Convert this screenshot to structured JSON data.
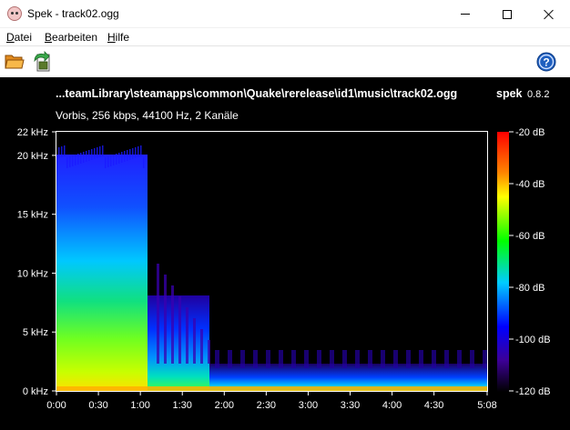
{
  "window": {
    "title": "Spek - track02.ogg",
    "controls": [
      "minimize",
      "maximize",
      "close"
    ]
  },
  "menu": {
    "items": [
      {
        "label": "Datei",
        "accel": "D",
        "rest": "atei"
      },
      {
        "label": "Bearbeiten",
        "accel": "B",
        "rest": "earbeiten"
      },
      {
        "label": "Hilfe",
        "accel": "H",
        "rest": "ilfe"
      }
    ]
  },
  "toolbar": {
    "icons": [
      "open-folder-icon",
      "save-icon",
      "help-icon"
    ],
    "help_glyph": "?"
  },
  "spectrogram": {
    "file_path": "...teamLibrary\\steamapps\\common\\Quake\\rerelease\\id1\\music\\track02.ogg",
    "app_name": "spek",
    "app_version": "0.8.2",
    "audio_info": "Vorbis, 256 kbps, 44100 Hz, 2 Kanäle",
    "colors": {
      "background": "#000000",
      "text": "#ffffff"
    }
  },
  "chart_data": {
    "type": "heatmap",
    "title": "...teamLibrary\\steamapps\\common\\Quake\\rerelease\\id1\\music\\track02.ogg",
    "subtitle": "Vorbis, 256 kbps, 44100 Hz, 2 Kanäle",
    "xlabel": "",
    "ylabel": "",
    "x_range_seconds": [
      0,
      308
    ],
    "y_range_khz": [
      0,
      22
    ],
    "x_ticks": [
      "0:00",
      "0:30",
      "1:00",
      "1:30",
      "2:00",
      "2:30",
      "3:00",
      "3:30",
      "4:00",
      "4:30",
      "5:08"
    ],
    "y_ticks": [
      "0 kHz",
      "5 kHz",
      "10 kHz",
      "15 kHz",
      "20 kHz",
      "22 kHz"
    ],
    "color_scale": {
      "range_db": [
        -120,
        -20
      ],
      "ticks": [
        "-20 dB",
        "-40 dB",
        "-60 dB",
        "-80 dB",
        "-100 dB",
        "-120 dB"
      ],
      "colors": [
        "#ff0000",
        "#ffff00",
        "#00ff00",
        "#00c8ff",
        "#0000ff",
        "#3c0096",
        "#000000"
      ]
    },
    "grid": false
  }
}
